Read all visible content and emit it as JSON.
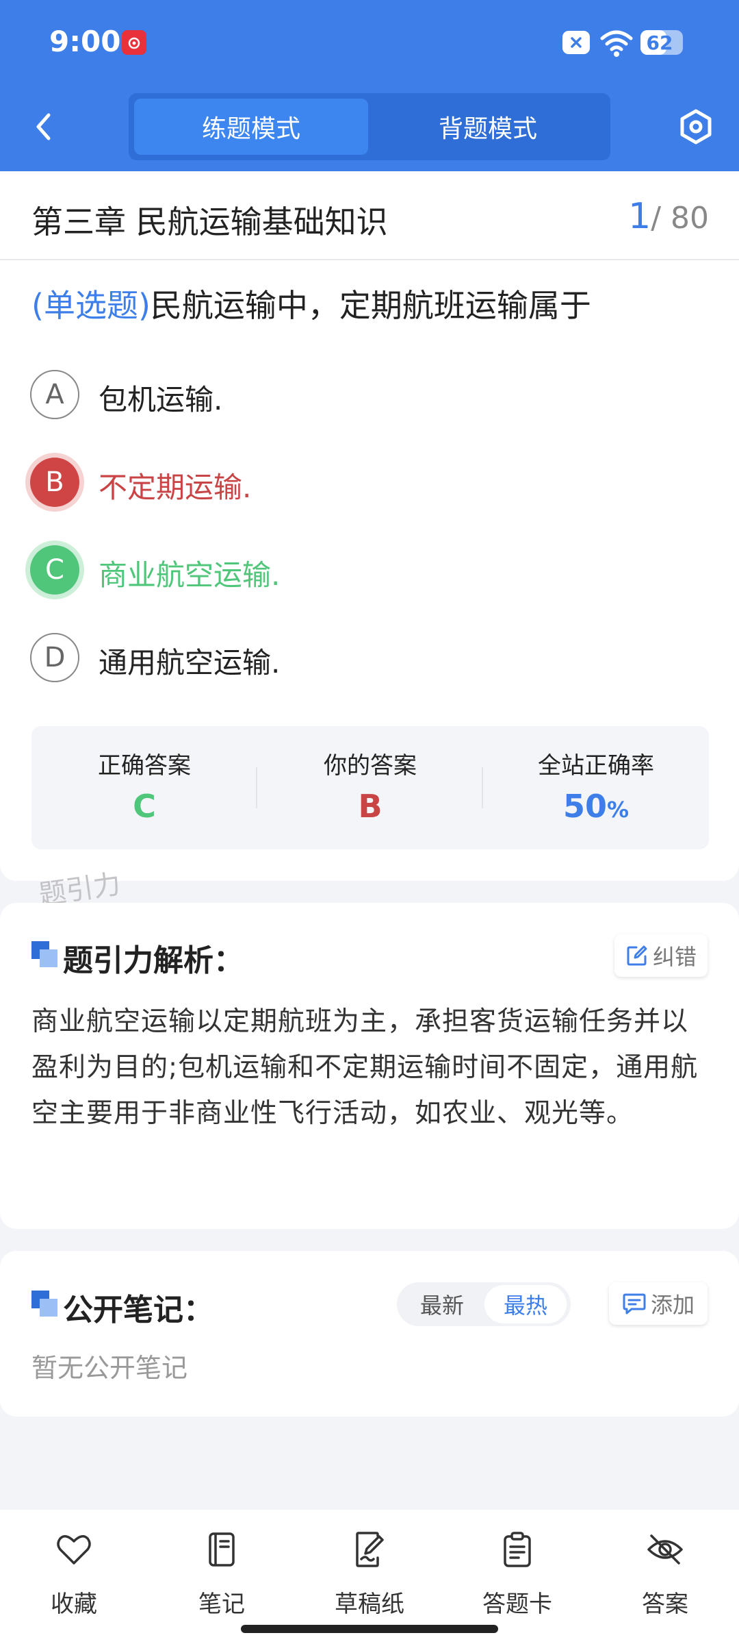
{
  "status": {
    "time": "9:00",
    "battery": "62",
    "battery_level": 0.62
  },
  "header": {
    "modes": [
      "练题模式",
      "背题模式"
    ],
    "active_mode": 0
  },
  "chapter": {
    "title": "第三章 民航运输基础知识",
    "current": "1",
    "total": "/ 80"
  },
  "question": {
    "type": "(单选题)",
    "text": "民航运输中，定期航班运输属于",
    "options": [
      {
        "letter": "A",
        "text": "包机运输.",
        "state": "normal"
      },
      {
        "letter": "B",
        "text": "不定期运输.",
        "state": "wrong"
      },
      {
        "letter": "C",
        "text": "商业航空运输.",
        "state": "right"
      },
      {
        "letter": "D",
        "text": "通用航空运输.",
        "state": "normal"
      }
    ]
  },
  "stats": {
    "correct_label": "正确答案",
    "correct_value": "C",
    "your_label": "你的答案",
    "your_value": "B",
    "rate_label": "全站正确率",
    "rate_value": "50",
    "rate_unit": "%"
  },
  "watermark": "题引力",
  "analysis": {
    "title": "题引力解析：",
    "report_label": "纠错",
    "text": "商业航空运输以定期航班为主，承担客货运输任务并以盈利为目的;包机运输和不定期运输时间不固定，通用航空主要用于非商业性飞行活动，如农业、观光等。"
  },
  "notes": {
    "title": "公开笔记：",
    "sort_options": [
      "最新",
      "最热"
    ],
    "add_label": "添加",
    "empty": "暂无公开笔记"
  },
  "bottom_nav": [
    {
      "label": "收藏",
      "icon": "heart-icon"
    },
    {
      "label": "笔记",
      "icon": "notebook-icon"
    },
    {
      "label": "草稿纸",
      "icon": "draft-paper-icon"
    },
    {
      "label": "答题卡",
      "icon": "clipboard-icon"
    },
    {
      "label": "答案",
      "icon": "eye-off-icon"
    }
  ],
  "colors": {
    "primary": "#3d7ee8",
    "correct": "#4fc67a",
    "wrong": "#c94545"
  }
}
